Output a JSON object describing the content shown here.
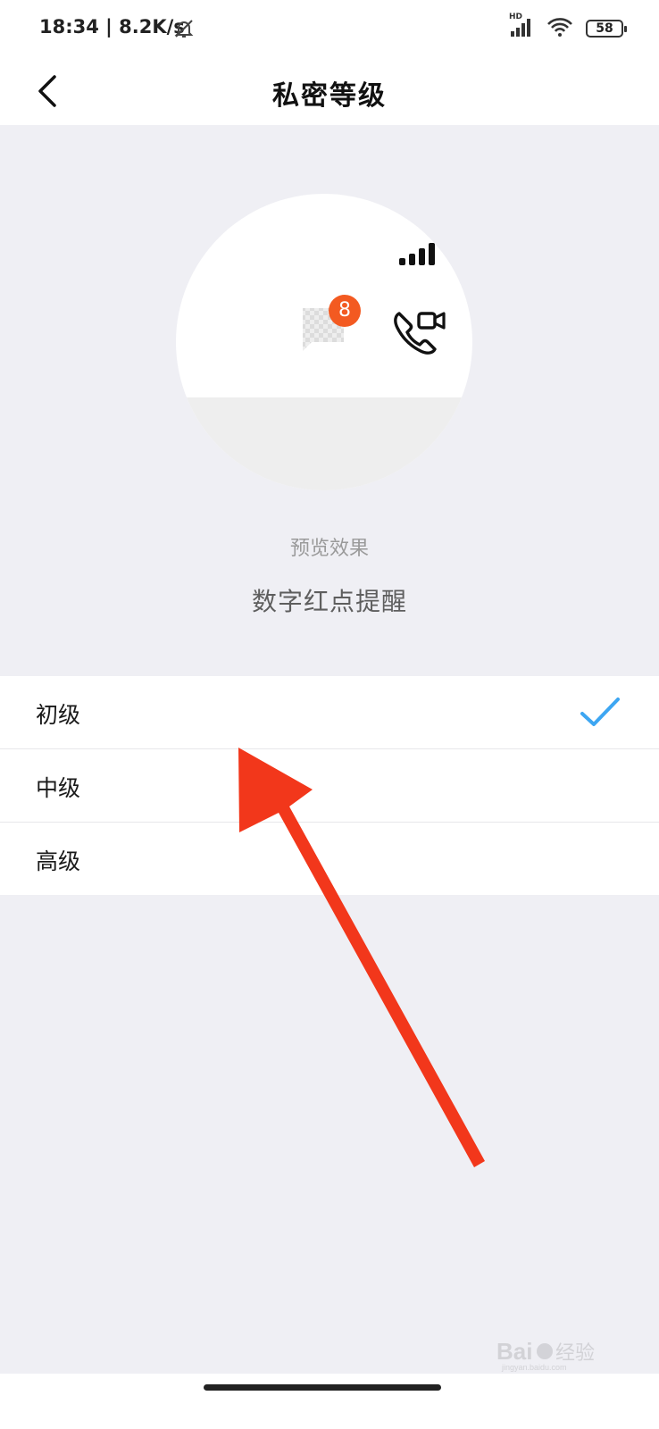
{
  "status_bar": {
    "time": "18:34 | 8.2K/s",
    "network_label": "HD",
    "battery": "58"
  },
  "header": {
    "title": "私密等级"
  },
  "preview": {
    "badge_count": "8",
    "label": "预览效果",
    "description": "数字红点提醒"
  },
  "options": {
    "items": [
      {
        "label": "初级",
        "selected": true
      },
      {
        "label": "中级",
        "selected": false
      },
      {
        "label": "高级",
        "selected": false
      }
    ]
  },
  "colors": {
    "accent_check": "#3da6f2",
    "badge": "#f35a21",
    "annotation_arrow": "#f2371b"
  },
  "watermark": {
    "logo_text": "Baidu经验",
    "url": "jingyan.baidu.com"
  }
}
